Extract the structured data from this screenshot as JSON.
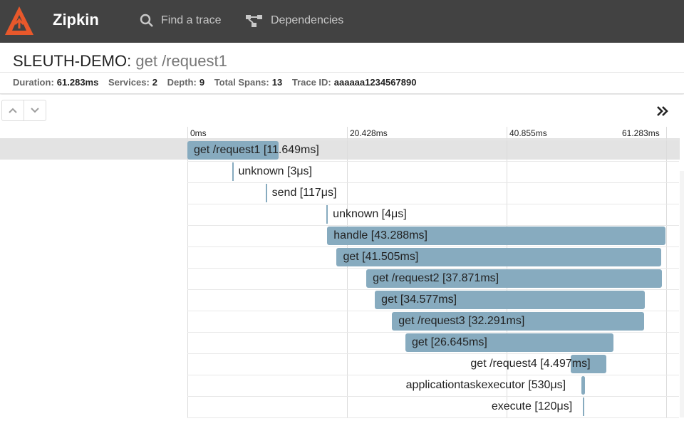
{
  "header": {
    "brand": "Zipkin",
    "nav": {
      "find_trace": "Find a trace",
      "dependencies": "Dependencies"
    },
    "logo_color": "#e8582b"
  },
  "trace": {
    "service_name": "SLEUTH-DEMO:",
    "operation_name": "get /request1",
    "meta": {
      "duration_label": "Duration:",
      "duration": "61.283ms",
      "services_label": "Services:",
      "services": "2",
      "depth_label": "Depth:",
      "depth": "9",
      "spans_label": "Total Spans:",
      "spans": "13",
      "trace_id_label": "Trace ID:",
      "trace_id": "aaaaaa1234567890"
    }
  },
  "timeline": {
    "ticks": [
      "0ms",
      "20.428ms",
      "40.855ms",
      "61.283ms"
    ],
    "bar_color": "#87abbf",
    "spans": [
      {
        "label": "get /request1 [11.649ms]",
        "start_ms": 0.0,
        "duration_ms": 11.649
      },
      {
        "label": "unknown [3μs]",
        "start_ms": 5.7,
        "duration_ms": 0.003
      },
      {
        "label": "send [117μs]",
        "start_ms": 10.0,
        "duration_ms": 0.117
      },
      {
        "label": "unknown [4μs]",
        "start_ms": 17.8,
        "duration_ms": 0.004
      },
      {
        "label": "handle [43.288ms]",
        "start_ms": 17.9,
        "duration_ms": 43.288
      },
      {
        "label": "get [41.505ms]",
        "start_ms": 19.1,
        "duration_ms": 41.505
      },
      {
        "label": "get /request2 [37.871ms]",
        "start_ms": 22.9,
        "duration_ms": 37.871
      },
      {
        "label": "get [34.577ms]",
        "start_ms": 24.0,
        "duration_ms": 34.577
      },
      {
        "label": "get /request3 [32.291ms]",
        "start_ms": 26.2,
        "duration_ms": 32.291
      },
      {
        "label": "get [26.645ms]",
        "start_ms": 27.9,
        "duration_ms": 26.645
      },
      {
        "label": "get /request4 [4.497ms]",
        "start_ms": 49.1,
        "duration_ms": 4.497
      },
      {
        "label": "applicationtaskexecutor [530μs]",
        "start_ms": 50.4,
        "duration_ms": 0.53
      },
      {
        "label": "execute [120μs]",
        "start_ms": 50.6,
        "duration_ms": 0.12
      }
    ]
  }
}
